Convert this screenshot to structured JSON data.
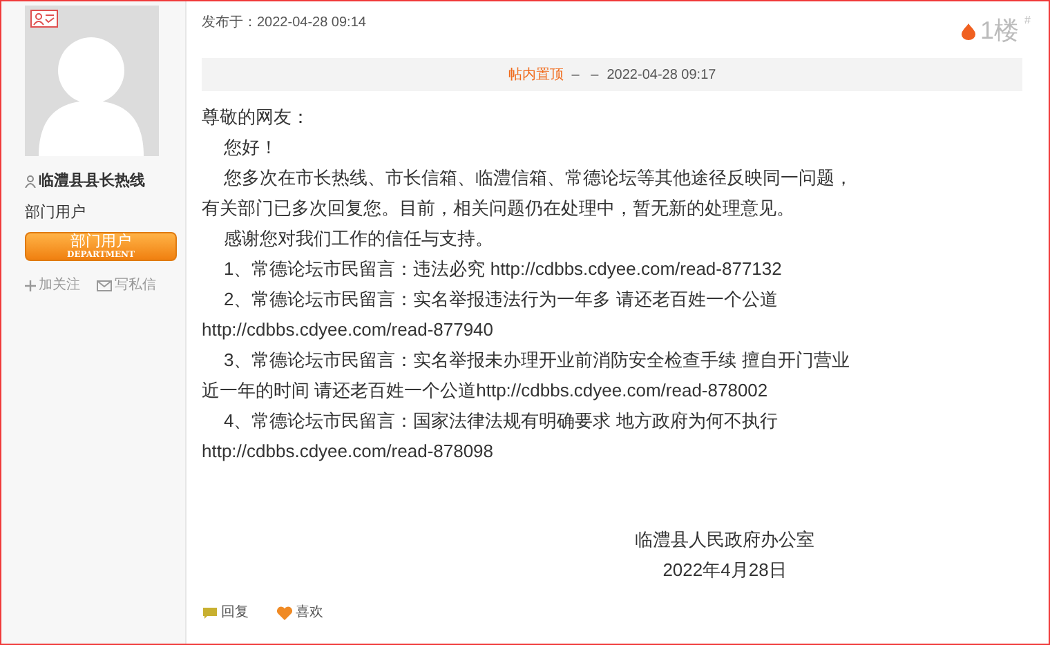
{
  "author": {
    "name": "临澧县县长热线",
    "group": "部门用户",
    "badge_title": "部门用户",
    "badge_subtitle": "DEPARTMENT",
    "actions": [
      {
        "label": "加关注",
        "kind": "follow"
      },
      {
        "label": "写私信",
        "kind": "message"
      }
    ]
  },
  "post": {
    "published": "发布于：2022-04-28 09:14",
    "floor": "1楼",
    "floor_mark": "#",
    "pin_notice": {
      "label": "帖内置顶",
      "separator": "–   –",
      "time": "2022-04-28 09:17"
    },
    "greeting": "尊敬的网友：",
    "paragraphs": [
      "您好！",
      "您多次在市长热线、市长信箱、临澧信箱、常德论坛等其他途径反映同一问题，有关部门已多次回复您。目前，相关问题仍在处理中，暂无新的处理意见。",
      "感谢您对我们工作的信任与支持。",
      "1、常德论坛市民留言：违法必究 http://cdbbs.cdyee.com/read-877132",
      "2、常德论坛市民留言：实名举报违法行为一年多 请还老百姓一个公道 http://cdbbs.cdyee.com/read-877940",
      "3、常德论坛市民留言：实名举报未办理开业前消防安全检查手续 擅自开门营业近一年的时间 请还老百姓一个公道http://cdbbs.cdyee.com/read-878002",
      "4、常德论坛市民留言：国家法律法规有明确要求 地方政府为何不执行 http://cdbbs.cdyee.com/read-878098"
    ],
    "signature": [
      "临澧县人民政府办公室",
      "2022年4月28日"
    ],
    "actions": [
      {
        "label": "回复",
        "kind": "reply"
      },
      {
        "label": "喜欢",
        "kind": "like"
      }
    ]
  }
}
